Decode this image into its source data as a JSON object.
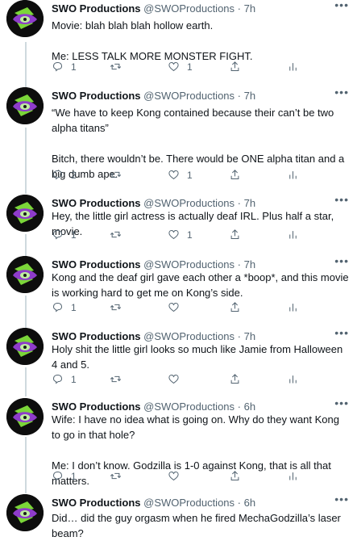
{
  "account": {
    "name": "SWO Productions",
    "handle": "@SWOProductions",
    "separator": "·"
  },
  "icons": {
    "reply": "reply-icon",
    "retweet": "retweet-icon",
    "like": "heart-icon",
    "share": "share-icon",
    "analytics": "analytics-icon",
    "more": "more-icon"
  },
  "tweets": [
    {
      "time": "7h",
      "text": "Movie: blah blah blah hollow earth.\n\nMe: LESS TALK MORE MONSTER FIGHT.",
      "replies": "1",
      "likes": "1"
    },
    {
      "time": "7h",
      "text": "“We have to keep Kong contained because their can’t be two alpha titans”\n\nBitch, there wouldn’t be. There would be ONE alpha titan and a big dumb ape.",
      "replies": "2",
      "likes": "1"
    },
    {
      "time": "7h",
      "text": "Hey, the little girl actress is actually deaf IRL. Plus half a star, movie.",
      "replies": "1",
      "likes": "1"
    },
    {
      "time": "7h",
      "text": "Kong and the deaf girl gave each other a *boop*, and this movie is working hard to get me on Kong’s side.",
      "replies": "1",
      "likes": ""
    },
    {
      "time": "7h",
      "text": "Holy shit the little girl looks so much like Jamie from Halloween 4 and 5.",
      "replies": "1",
      "likes": ""
    },
    {
      "time": "6h",
      "text": "Wife: I have no idea what is going on. Why do they want Kong to go in that hole?\n\nMe: I don’t know. Godzilla is 1-0 against Kong, that is all that matters.",
      "replies": "1",
      "likes": ""
    },
    {
      "time": "6h",
      "text": "Did… did the guy orgasm when he fired MechaGodzilla’s laser beam?",
      "replies": "",
      "likes": ""
    }
  ]
}
